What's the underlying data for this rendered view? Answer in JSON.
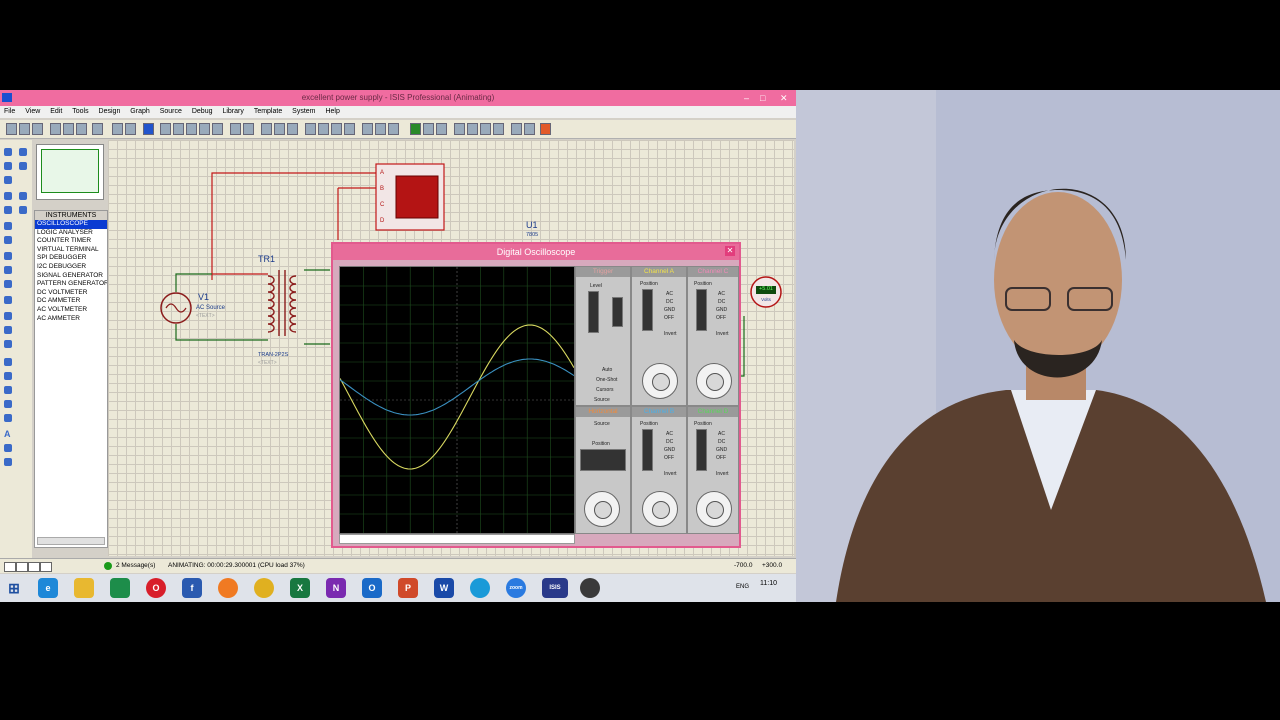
{
  "app": {
    "title": "excellent power supply - ISIS Professional (Animating)",
    "menu": [
      "File",
      "View",
      "Edit",
      "Tools",
      "Design",
      "Graph",
      "Source",
      "Debug",
      "Library",
      "Template",
      "System",
      "Help"
    ],
    "instruments_header": "INSTRUMENTS",
    "instruments": [
      "OSCILLOSCOPE",
      "LOGIC ANALYSER",
      "COUNTER TIMER",
      "VIRTUAL TERMINAL",
      "SPI DEBUGGER",
      "I2C DEBUGGER",
      "SIGNAL GENERATOR",
      "PATTERN GENERATOR",
      "DC VOLTMETER",
      "DC AMMETER",
      "AC VOLTMETER",
      "AC AMMETER"
    ],
    "selected_instrument_index": 0
  },
  "schematic": {
    "v1_label": "V1",
    "v1_sub": "AC Source",
    "v1_text": "<TEXT>",
    "tr1_label": "TR1",
    "tr1_sub": "TRAN-2P2S",
    "tr1_text": "<TEXT>",
    "u1_label": "U1",
    "u1_sub": "7805",
    "scope_pins": [
      "A",
      "B",
      "C",
      "D"
    ],
    "voltmeter_value": "+5.01",
    "voltmeter_unit": "Volts"
  },
  "oscilloscope": {
    "title": "Digital Oscilloscope",
    "channel_a": "Channel A",
    "channel_b": "Channel B",
    "channel_c": "Channel C",
    "channel_d": "Channel D",
    "trigger": "Trigger",
    "horizontal": "Horizontal",
    "level": "Level",
    "position": "Position",
    "source": "Source",
    "auto": "Auto",
    "one_shot": "One-Shot",
    "cursors": "Cursors",
    "coupling": [
      "AC",
      "DC",
      "GND",
      "OFF"
    ],
    "invert": "Invert",
    "colors": {
      "channel_a": "#d8d860",
      "channel_b": "#3a90c0",
      "grid": "#1f4f1f",
      "screen": "#000000"
    }
  },
  "status": {
    "messages": "2 Message(s)",
    "animating": "ANIMATING: 00:00:29.300001 (CPU load 37%)",
    "coord_x": "-700.0",
    "coord_y": "+300.0"
  },
  "taskbar": {
    "apps": [
      "windows-start",
      "edge",
      "file-explorer",
      "excel-green",
      "opera",
      "facebook",
      "firefox",
      "chrome",
      "excel",
      "onenote",
      "outlook",
      "powerpoint",
      "word",
      "edge-new",
      "zoom",
      "isis",
      "proteus"
    ],
    "time": "11:10",
    "lang": "ENG"
  }
}
